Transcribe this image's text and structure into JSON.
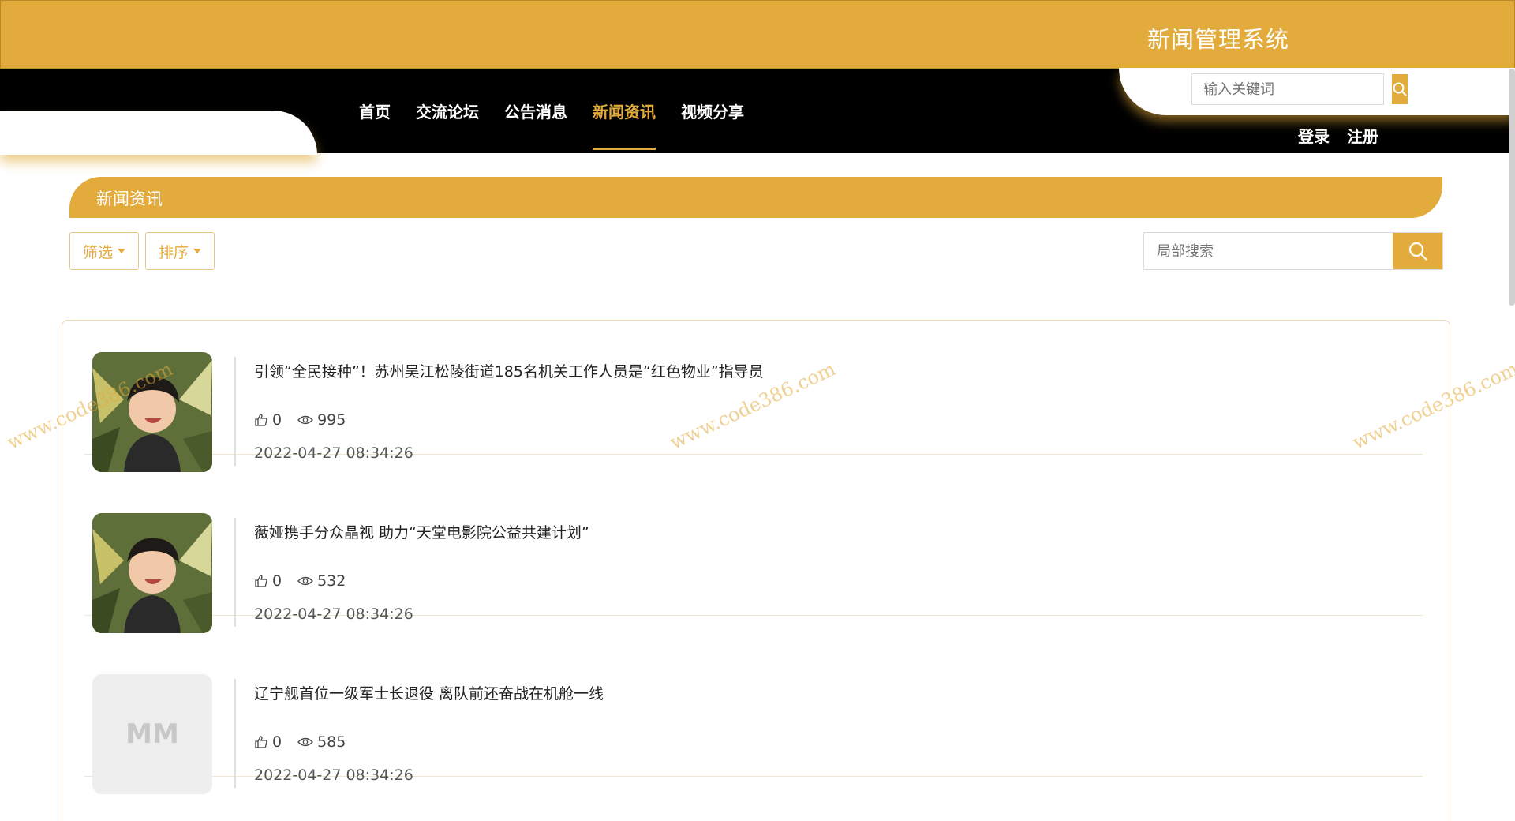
{
  "header": {
    "site_title": "新闻管理系统"
  },
  "nav": {
    "items": [
      {
        "label": "首页",
        "active": false
      },
      {
        "label": "交流论坛",
        "active": false
      },
      {
        "label": "公告消息",
        "active": false
      },
      {
        "label": "新闻资讯",
        "active": true
      },
      {
        "label": "视频分享",
        "active": false
      }
    ],
    "search_placeholder": "输入关键词",
    "login_label": "登录",
    "register_label": "注册"
  },
  "section": {
    "title": "新闻资讯"
  },
  "filters": {
    "filter_label": "筛选",
    "sort_label": "排序",
    "search_placeholder": "局部搜索"
  },
  "news": [
    {
      "title": "引领“全民接种”！苏州吴江松陵街道185名机关工作人员是“红色物业”指导员",
      "likes": "0",
      "views": "995",
      "date": "2022-04-27 08:34:26",
      "thumb": "avatar-photo"
    },
    {
      "title": "薇娅携手分众晶视 助力“天堂电影院公益共建计划”",
      "likes": "0",
      "views": "532",
      "date": "2022-04-27 08:34:26",
      "thumb": "avatar-photo"
    },
    {
      "title": "辽宁舰首位一级军士长退役 离队前还奋战在机舱一线",
      "likes": "0",
      "views": "585",
      "date": "2022-04-27 08:34:26",
      "thumb": "placeholder",
      "thumb_text": "MM"
    }
  ],
  "watermark": {
    "text": "www.code386.com"
  },
  "colors": {
    "accent": "#e3ab3b",
    "nav_bg": "#000000"
  }
}
